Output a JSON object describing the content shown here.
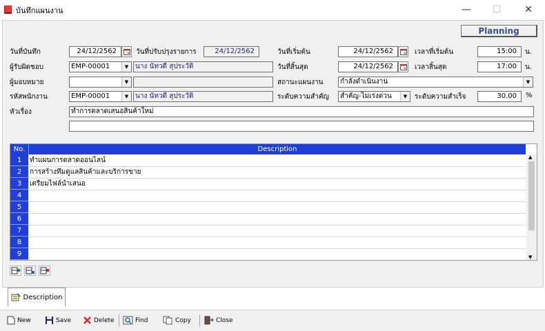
{
  "window": {
    "title": "บันทึกแผนงาน",
    "icon": "book-icon"
  },
  "header": {
    "planning_label": "Planning"
  },
  "form": {
    "record_date_label": "วันที่บันทึก",
    "record_date": "24/12/2562",
    "updated_date_label": "วันที่ปรับปรุงรายการ",
    "updated_date": "24/12/2562",
    "start_date_label": "วันที่เริ่มต้น",
    "start_date": "24/12/2562",
    "start_time_label": "เวลาที่เริ่มต้น",
    "start_time": "15:00",
    "start_unit": "น.",
    "responsible_label": "ผู้รับผิดชอบ",
    "responsible_code": "EMP-00001",
    "responsible_name": "นาง นัทวดี สุประวัติ",
    "end_date_label": "วันที่สิ้นสุด",
    "end_date": "24/12/2562",
    "end_time_label": "เวลาสิ้นสุด",
    "end_time": "17:00",
    "end_unit": "น.",
    "assigner_label": "ผู้มอบหมาย",
    "assigner_code": "",
    "assigner_name": "",
    "plan_status_label": "สถานะแผนงาน",
    "plan_status": "กำลังดำเนินงาน",
    "employee_code_label": "รหัสพนักงาน",
    "employee_code": "EMP-00001",
    "employee_name": "นาง นัทวดี สุประวัติ",
    "priority_label": "ระดับความสำคัญ",
    "priority": "สำคัญ-ไม่เร่งด่วน",
    "success_label": "ระดับความสำเร็จ",
    "success_value": "30.00",
    "success_unit": "%",
    "subject_label": "หัวเรื่อง",
    "subject_line1": "ทำการตลาดเสนอสินค้าใหม่",
    "subject_line2": ""
  },
  "grid": {
    "col_no": "No.",
    "col_desc": "Description",
    "rows": [
      {
        "no": "1",
        "desc": "ทำแผนการตลาดออนไลน์"
      },
      {
        "no": "2",
        "desc": "การสร้างทีมดูแลสินค้าและบริการขาย"
      },
      {
        "no": "3",
        "desc": "เตรียมไฟล์นำเสนอ"
      },
      {
        "no": "4",
        "desc": ""
      },
      {
        "no": "5",
        "desc": ""
      },
      {
        "no": "6",
        "desc": ""
      },
      {
        "no": "7",
        "desc": ""
      },
      {
        "no": "8",
        "desc": ""
      },
      {
        "no": "9",
        "desc": ""
      }
    ]
  },
  "tabs": {
    "description": "Description"
  },
  "toolbar": {
    "new": "New",
    "save": "Save",
    "delete": "Delete",
    "find": "Find",
    "copy": "Copy",
    "close": "Close"
  },
  "colors": {
    "grid_header": "#1f3fd8",
    "planning_text": "#3b4e8c",
    "name_text": "#1a237e"
  }
}
